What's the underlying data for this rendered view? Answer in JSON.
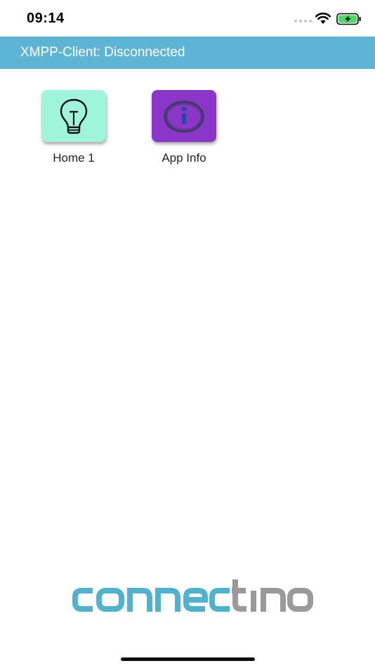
{
  "status_bar": {
    "time": "09:14",
    "icons": [
      "signal-dots-icon",
      "wifi-icon",
      "battery-charging-icon"
    ],
    "battery_color": "#4cd964"
  },
  "header": {
    "title": "XMPP-Client: Disconnected",
    "background_color": "#5db4d4",
    "text_color": "#ffffff"
  },
  "tiles": [
    {
      "label": "Home 1",
      "icon": "lightbulb-icon",
      "background_color": "#9ff5d9"
    },
    {
      "label": "App Info",
      "icon": "info-icon",
      "background_color": "#8b36c8"
    }
  ],
  "footer": {
    "logo_text": "connectino",
    "logo_colors": {
      "primary": "#4fb3d0",
      "secondary": "#9a9a9a"
    }
  }
}
